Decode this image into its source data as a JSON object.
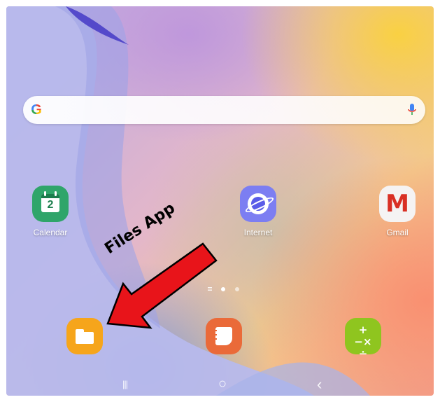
{
  "search": {
    "brand": "G"
  },
  "apps": {
    "calendar": {
      "label": "Calendar",
      "date": "2"
    },
    "internet": {
      "label": "Internet"
    },
    "gmail": {
      "label": "Gmail",
      "glyph": "M"
    }
  },
  "dock": {
    "files": {
      "name": "folder-icon"
    },
    "notes": {
      "name": "notes-icon"
    },
    "calculator": {
      "glyph": "+−×÷"
    }
  },
  "annotation": {
    "text": "Files App",
    "arrow_color": "#e8141a"
  },
  "page_indicator": {
    "count": 3,
    "active": 2
  },
  "nav": {
    "recents": "|||",
    "home": "○",
    "back": "‹"
  }
}
